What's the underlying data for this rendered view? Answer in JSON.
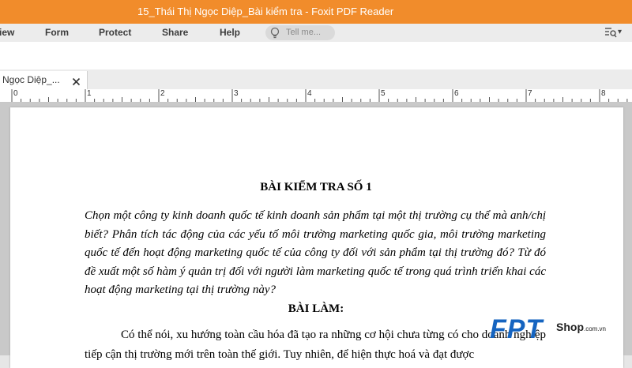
{
  "window": {
    "title": "15_Thái Thị Ngọc Diệp_Bài kiểm tra - Foxit PDF Reader"
  },
  "menu": {
    "items": [
      {
        "id": "view",
        "label": "iew"
      },
      {
        "id": "form",
        "label": "Form"
      },
      {
        "id": "protect",
        "label": "Protect"
      },
      {
        "id": "share",
        "label": "Share"
      },
      {
        "id": "help",
        "label": "Help"
      }
    ],
    "tell_me_placeholder": "Tell me..."
  },
  "tabs": [
    {
      "label": "Ngọc Diệp_..."
    }
  ],
  "ruler": {
    "labels": [
      "0",
      "1",
      "2",
      "3",
      "4",
      "5",
      "6",
      "7",
      "8"
    ]
  },
  "document": {
    "title": "BÀI KIỂM TRA SỐ 1",
    "question": "Chọn một công ty kinh doanh quốc tế kinh doanh sản phẩm tại một thị trường cụ thể mà anh/chị biết? Phân tích tác động của các yếu tố môi trường marketing quốc gia, môi trường marketing quốc tế đến hoạt động marketing quốc tế của công ty đối với sản phẩm tại thị trường đó? Từ đó đề xuất một số hàm ý quản trị đối với người làm marketing quốc tế trong quá trình triển khai các hoạt động marketing tại thị trường này?",
    "answer_heading": "BÀI LÀM:",
    "body": "Có thể nói, xu hướng toàn cầu hóa đã tạo ra những cơ hội chưa từng có cho doanh nghiệp tiếp cận thị trường mới trên toàn thế giới. Tuy nhiên, để hiện thực hoá và đạt được"
  },
  "watermark": {
    "letters": "FPT",
    "shop": "Shop",
    "domain": ".com.vn"
  },
  "colors": {
    "titlebar": "#f18c2b",
    "watermark_blue": "#1564c0"
  }
}
